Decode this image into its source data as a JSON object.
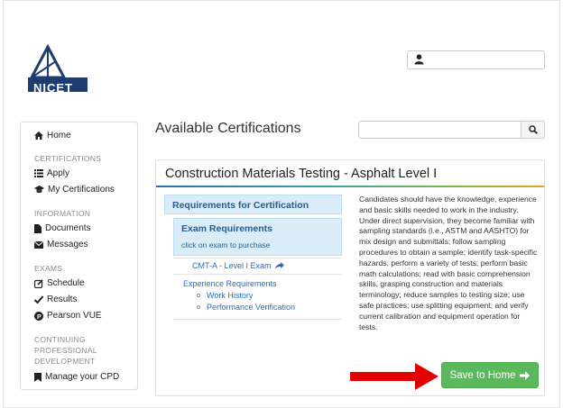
{
  "logo": {
    "text": "NICET"
  },
  "header": {
    "user_icon": "user-icon"
  },
  "sidebar": {
    "home": "Home",
    "certifications_head": "CERTIFICATIONS",
    "apply": "Apply",
    "my_certs": "My Certifications",
    "information_head": "INFORMATION",
    "documents": "Documents",
    "messages": "Messages",
    "exams_head": "EXAMS",
    "schedule": "Schedule",
    "results": "Results",
    "pearson": "Pearson VUE",
    "cpd_head_1": "CONTINUING",
    "cpd_head_2": "PROFESSIONAL",
    "cpd_head_3": "DEVELOPMENT",
    "manage_cpd": "Manage your CPD"
  },
  "main": {
    "title": "Available Certifications",
    "search_placeholder": ""
  },
  "card": {
    "title": "Construction Materials Testing - Asphalt Level I",
    "requirements_label": "Requirements for Certification",
    "exam_req_label": "Exam Requirements",
    "exam_req_sub": "click on exam to purchase",
    "exam_link": "CMT-A - Level I Exam",
    "experience_label": "Experience Requirements",
    "work_history": "Work History",
    "performance_verification": "Performance Verification",
    "description": "Candidates should have the knowledge, experience and basic skills needed to work in the industry. Under direct supervision, they become familiar with sampling standards (i.e., ASTM and AASHTO) for mix design and submittals; follow sampling procedures to obtain a sample; identify task-specific hazards; perform a variety of tests; perform basic math calculations; read with basic comprehension skills, grasping construction and materials terminology; reduce samples to testing size; use safe practices; use splitting equipment; and verify current calibration and equipment operation for tests.",
    "save_button": "Save to Home"
  },
  "colors": {
    "accent_green": "#5cb85c",
    "link_blue": "#2a6ebb",
    "panel_blue": "#d9ecf7",
    "logo_navy": "#1f3d70",
    "arrow_red": "#e30000"
  }
}
